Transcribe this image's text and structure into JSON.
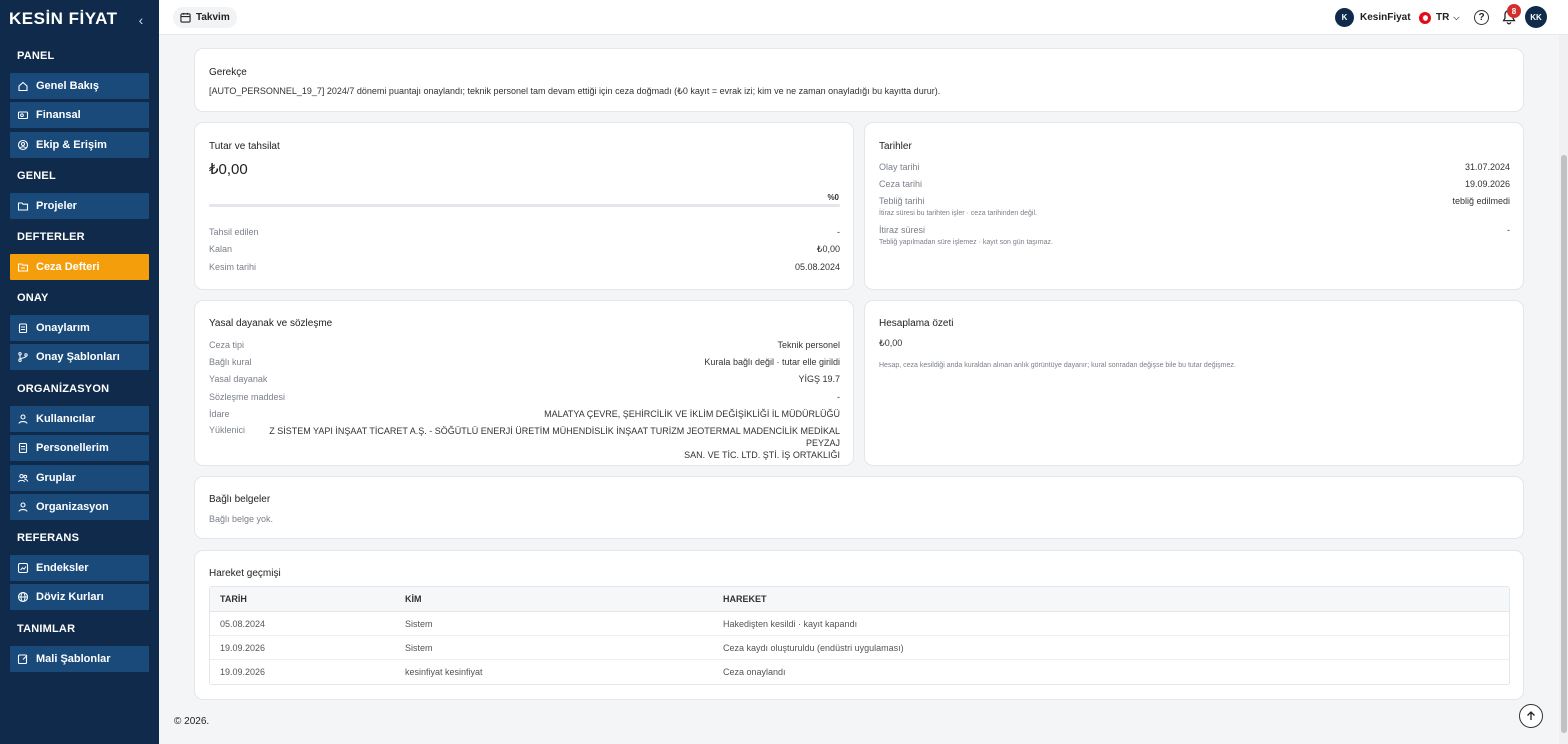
{
  "brand": {
    "logo": "KESİN FİYAT"
  },
  "sidebar": {
    "sections": [
      {
        "title": "PANEL",
        "items": [
          {
            "label": "Genel Bakış",
            "icon": "home-icon"
          },
          {
            "label": "Finansal",
            "icon": "wallet-icon"
          },
          {
            "label": "Ekip & Erişim",
            "icon": "team-icon"
          }
        ]
      },
      {
        "title": "GENEL",
        "items": [
          {
            "label": "Projeler",
            "icon": "folder-icon"
          }
        ]
      },
      {
        "title": "DEFTERLER",
        "items": [
          {
            "label": "Ceza Defteri",
            "icon": "ledger-icon",
            "active": true
          }
        ]
      },
      {
        "title": "ONAY",
        "items": [
          {
            "label": "Onaylarım",
            "icon": "clipboard-icon"
          },
          {
            "label": "Onay Şablonları",
            "icon": "branch-icon"
          }
        ]
      },
      {
        "title": "ORGANİZASYON",
        "items": [
          {
            "label": "Kullanıcılar",
            "icon": "user-icon"
          },
          {
            "label": "Personellerim",
            "icon": "id-card-icon"
          },
          {
            "label": "Gruplar",
            "icon": "group-icon"
          },
          {
            "label": "Organizasyon",
            "icon": "org-icon"
          }
        ]
      },
      {
        "title": "REFERANS",
        "items": [
          {
            "label": "Endeksler",
            "icon": "chart-icon"
          },
          {
            "label": "Döviz Kurları",
            "icon": "globe-icon"
          }
        ]
      },
      {
        "title": "TANIMLAR",
        "items": [
          {
            "label": "Mali Şablonlar",
            "icon": "edit-icon"
          }
        ]
      }
    ]
  },
  "topbar": {
    "tab_label": "Takvim",
    "user_initial": "K",
    "user_name": "KesinFiyat",
    "lang": "TR",
    "help": "?",
    "notification_count": "8",
    "avatar": "KK"
  },
  "reason": {
    "title": "Gerekçe",
    "text": "[AUTO_PERSONNEL_19_7] 2024/7 dönemi puantajı onaylandı; teknik personel tam devam ettiği için ceza doğmadı (₺0 kayıt = evrak izi; kim ve ne zaman onayladığı bu kayıtta durur)."
  },
  "amount": {
    "title": "Tutar ve tahsilat",
    "total": "₺0,00",
    "percent_label": "%0",
    "progress": 0,
    "rows": [
      {
        "k": "Tahsil edilen",
        "v": "-"
      },
      {
        "k": "Kalan",
        "v": "₺0,00"
      },
      {
        "k": "Kesim tarihi",
        "v": "05.08.2024"
      }
    ]
  },
  "dates": {
    "title": "Tarihler",
    "rows": [
      {
        "k": "Olay tarihi",
        "v": "31.07.2024"
      },
      {
        "k": "Ceza tarihi",
        "v": "19.09.2026"
      },
      {
        "k": "Tebliğ tarihi",
        "v": "tebliğ edilmedi"
      },
      {
        "k": "İtiraz süresi",
        "v": "-"
      }
    ],
    "hint1": "İtiraz süresi bu tarihten işler · ceza tarihinden değil.",
    "hint2": "Tebliğ yapılmadan süre işlemez · kayıt son gün taşımaz."
  },
  "legal": {
    "title": "Yasal dayanak ve sözleşme",
    "rows": [
      {
        "k": "Ceza tipi",
        "v": "Teknik personel"
      },
      {
        "k": "Bağlı kural",
        "v": "Kurala bağlı değil · tutar elle girildi"
      },
      {
        "k": "Yasal dayanak",
        "v": "YİGŞ 19.7"
      },
      {
        "k": "Sözleşme maddesi",
        "v": "-"
      },
      {
        "k": "İdare",
        "v": "MALATYA ÇEVRE, ŞEHİRCİLİK VE İKLİM DEĞİŞİKLİĞİ İL MÜDÜRLÜĞÜ"
      }
    ],
    "contractor_label": "Yüklenici",
    "contractor_line1": "Z SİSTEM YAPI İNŞAAT TİCARET A.Ş. - SÖĞÜTLÜ ENERJİ ÜRETİM MÜHENDİSLİK İNŞAAT TURİZM JEOTERMAL MADENCİLİK MEDİKAL PEYZAJ",
    "contractor_line2": "SAN. VE TİC. LTD. ŞTİ. İŞ ORTAKLIĞI"
  },
  "calc": {
    "title": "Hesaplama özeti",
    "amount": "₺0,00",
    "note": "Hesap, ceza kesildiği anda kuraldan alınan anlık görüntüye dayanır; kural sonradan değişse bile bu tutar değişmez."
  },
  "docs": {
    "title": "Bağlı belgeler",
    "empty": "Bağlı belge yok."
  },
  "history": {
    "title": "Hareket geçmişi",
    "headers": [
      "TARİH",
      "KİM",
      "HAREKET"
    ],
    "rows": [
      [
        "05.08.2024",
        "Sistem",
        "Hakedişten kesildi · kayıt kapandı"
      ],
      [
        "19.09.2026",
        "Sistem",
        "Ceza kaydı oluşturuldu (endüstri uygulaması)"
      ],
      [
        "19.09.2026",
        "kesinfiyat kesinfiyat",
        "Ceza onaylandı"
      ]
    ]
  },
  "footer": {
    "text": "© 2026."
  },
  "colors": {
    "sidebar": "#0f2a4a",
    "nav_item": "#1a4a7a",
    "active": "#f59e0b"
  }
}
